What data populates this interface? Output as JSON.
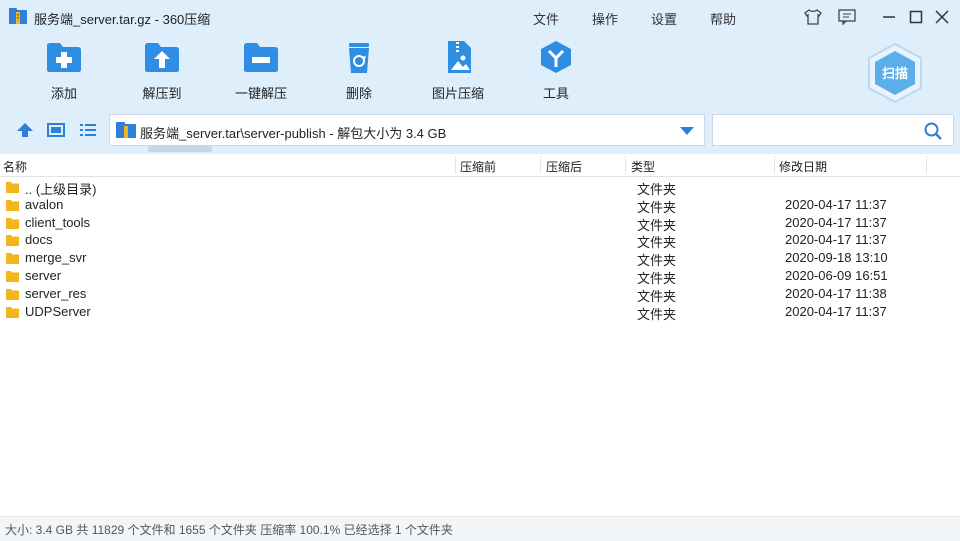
{
  "window": {
    "title": "服务端_server.tar.gz - 360压缩",
    "menu": [
      "文件",
      "操作",
      "设置",
      "帮助"
    ]
  },
  "toolbar": {
    "items": [
      {
        "label": "添加",
        "icon": "add-icon"
      },
      {
        "label": "解压到",
        "icon": "extract-to-icon"
      },
      {
        "label": "一键解压",
        "icon": "one-click-extract-icon"
      },
      {
        "label": "删除",
        "icon": "delete-icon"
      },
      {
        "label": "图片压缩",
        "icon": "image-compress-icon"
      },
      {
        "label": "工具",
        "icon": "tools-icon"
      }
    ],
    "scan_label": "扫描"
  },
  "address": {
    "path": "服务端_server.tar\\server-publish - 解包大小为 3.4 GB",
    "search_value": ""
  },
  "columns": {
    "name": "名称",
    "compressed_before": "压缩前",
    "compressed_after": "压缩后",
    "type": "类型",
    "modified": "修改日期"
  },
  "files": [
    {
      "name": ".. (上级目录)",
      "type": "文件夹",
      "date": ""
    },
    {
      "name": "avalon",
      "type": "文件夹",
      "date": "2020-04-17 11:37"
    },
    {
      "name": "client_tools",
      "type": "文件夹",
      "date": "2020-04-17 11:37"
    },
    {
      "name": "docs",
      "type": "文件夹",
      "date": "2020-04-17 11:37"
    },
    {
      "name": "merge_svr",
      "type": "文件夹",
      "date": "2020-09-18 13:10"
    },
    {
      "name": "server",
      "type": "文件夹",
      "date": "2020-06-09 16:51"
    },
    {
      "name": "server_res",
      "type": "文件夹",
      "date": "2020-04-17 11:38"
    },
    {
      "name": "UDPServer",
      "type": "文件夹",
      "date": "2020-04-17 11:37"
    }
  ],
  "status": {
    "text": "大小: 3.4 GB 共 11829 个文件和 1655 个文件夹 压缩率 100.1% 已经选择 1 个文件夹"
  },
  "colors": {
    "accent": "#2f7fd8",
    "chrome": "#dfeefb",
    "folder": "#f2b51d"
  }
}
